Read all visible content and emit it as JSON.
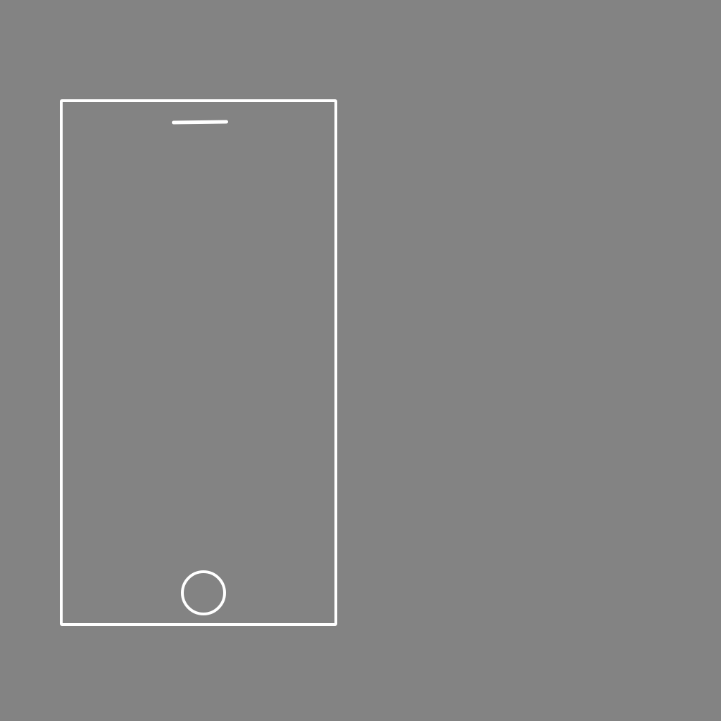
{
  "device": {
    "type": "phone-outline",
    "icons": {
      "speaker": "speaker-icon",
      "home_button": "home-button-icon"
    }
  },
  "colors": {
    "background": "#838383",
    "outline": "#ffffff"
  }
}
